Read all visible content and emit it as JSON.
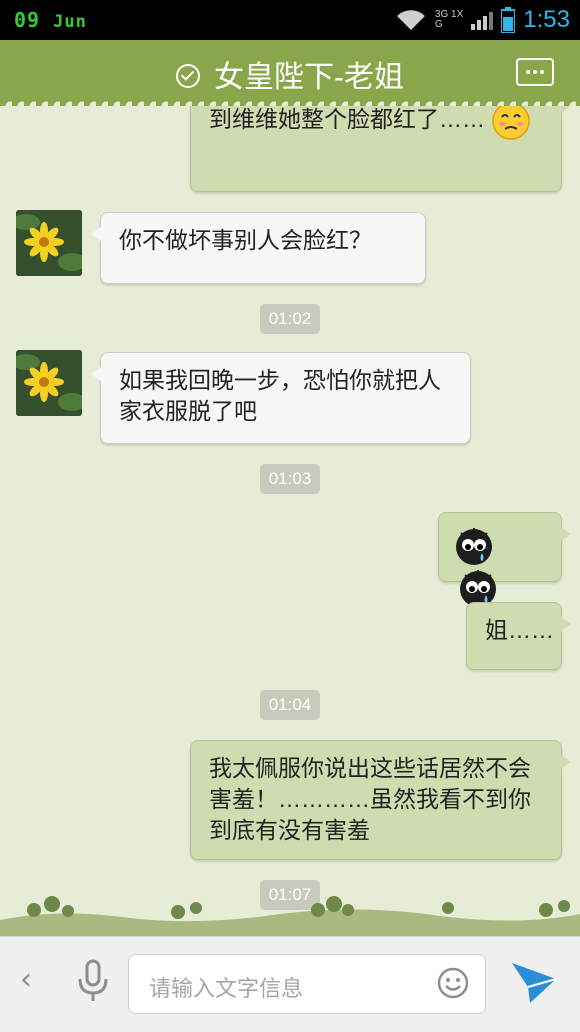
{
  "status_bar": {
    "day": "09",
    "month": "Jun",
    "time": "1:53",
    "net_top": "3G 1X",
    "net_g": "G"
  },
  "header": {
    "title": "女皇陛下-老姐"
  },
  "messages": [
    {
      "id": "m0",
      "dir": "out",
      "text": "到维维她整个脸都红了……"
    },
    {
      "id": "m1",
      "dir": "in",
      "text": "你不做坏事别人会脸红？"
    },
    {
      "id": "t1",
      "time": "01:02"
    },
    {
      "id": "m2",
      "dir": "in",
      "text": "如果我回晚一步，恐怕你就把人家衣服脱了吧"
    },
    {
      "id": "t2",
      "time": "01:03"
    },
    {
      "id": "m3",
      "dir": "out",
      "text": "",
      "emoji": [
        "crying-face",
        "crying-face"
      ]
    },
    {
      "id": "m4",
      "dir": "out",
      "text": "姐……"
    },
    {
      "id": "t3",
      "time": "01:04"
    },
    {
      "id": "m5",
      "dir": "out",
      "text": "我太佩服你说出这些话居然不会害羞！…………虽然我看不到你到底有没有害羞"
    },
    {
      "id": "t4",
      "time": "01:07"
    }
  ],
  "input": {
    "placeholder": "请输入文字信息"
  },
  "colors": {
    "accent": "#8aa64a",
    "chat_bg": "#e6ecd6",
    "out_bubble": "#cfdcb0",
    "send": "#2a8fd6"
  }
}
